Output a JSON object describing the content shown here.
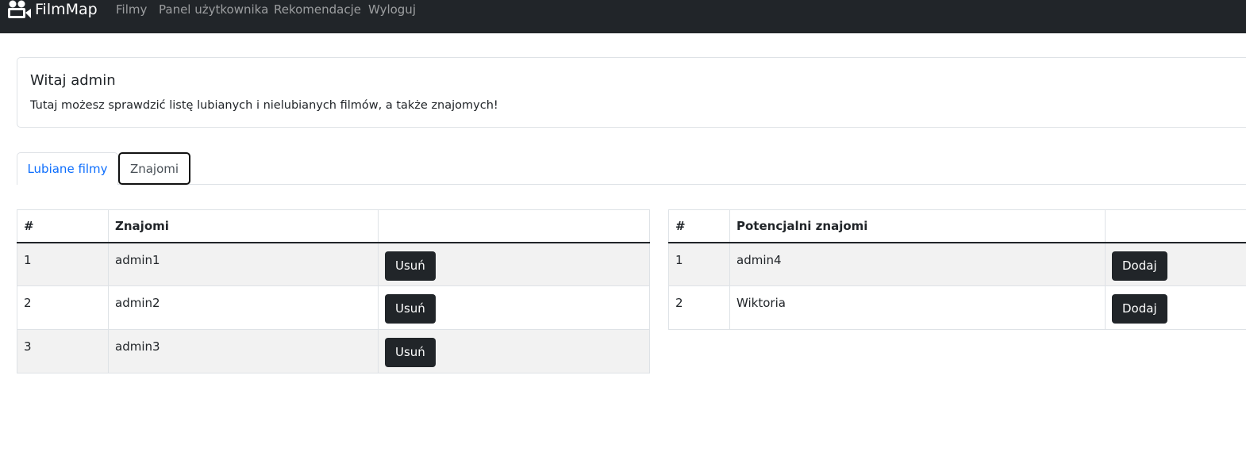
{
  "navbar": {
    "brand": "FilmMap",
    "brand_icon": "video-camera-icon",
    "links": [
      "Filmy",
      "Panel użytkownika",
      "Rekomendacje",
      "Wyloguj"
    ],
    "bg_color": "#212529"
  },
  "welcome": {
    "title": "Witaj admin",
    "text": "Tutaj możesz sprawdzić listę lubianych i nielubianych filmów, a także znajomych!"
  },
  "tabs": [
    {
      "label": "Lubiane filmy",
      "active": false
    },
    {
      "label": "Znajomi",
      "active": true
    }
  ],
  "friends_table": {
    "headers": [
      "#",
      "Znajomi",
      ""
    ],
    "rows": [
      {
        "num": "1",
        "name": "admin1",
        "action": "Usuń"
      },
      {
        "num": "2",
        "name": "admin2",
        "action": "Usuń"
      },
      {
        "num": "3",
        "name": "admin3",
        "action": "Usuń"
      }
    ]
  },
  "potential_table": {
    "headers": [
      "#",
      "Potencjalni znajomi",
      ""
    ],
    "rows": [
      {
        "num": "1",
        "name": "admin4",
        "action": "Dodaj"
      },
      {
        "num": "2",
        "name": "Wiktoria",
        "action": "Dodaj"
      }
    ]
  }
}
